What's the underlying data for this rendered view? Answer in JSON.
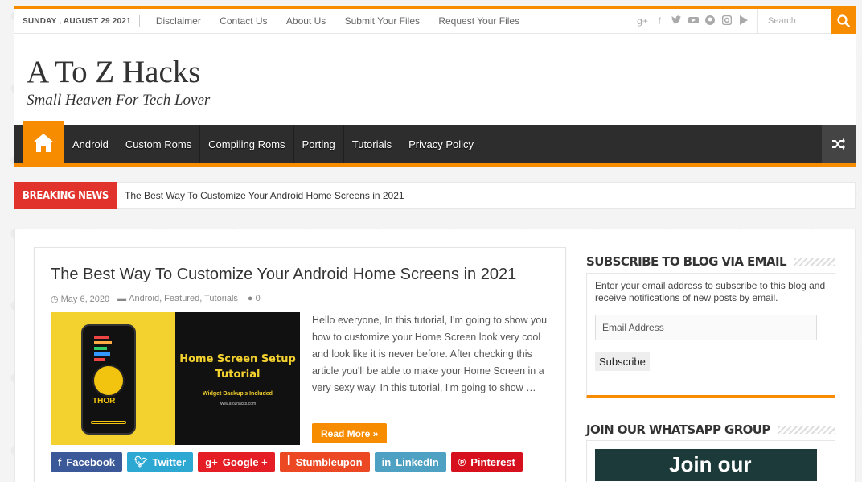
{
  "topbar": {
    "date": "SUNDAY , AUGUST 29 2021",
    "links": [
      "Disclaimer",
      "Contact Us",
      "About Us",
      "Submit Your Files",
      "Request Your Files"
    ],
    "social": [
      "google-plus",
      "facebook",
      "twitter",
      "youtube",
      "github",
      "instagram",
      "play"
    ],
    "search_placeholder": "Search"
  },
  "header": {
    "logo": "A To Z Hacks",
    "tagline": "Small Heaven For Tech Lover"
  },
  "nav": {
    "items": [
      "Android",
      "Custom Roms",
      "Compiling Roms",
      "Porting",
      "Tutorials",
      "Privacy Policy"
    ]
  },
  "breaking": {
    "label": "Breaking News",
    "text": "The Best Way To Customize Your Android Home Screens in 2021"
  },
  "post": {
    "title": "The Best Way To Customize Your Android Home Screens in 2021",
    "date": "May 6, 2020",
    "categories": "Android, Featured, Tutorials",
    "comments": "0",
    "thumb_title_1": "Home Screen Setup",
    "thumb_title_2": "Tutorial",
    "thumb_sub": "Widget Backup's Included",
    "thumb_url": "www.atozhacks.com",
    "thumb_badge": "THOR",
    "excerpt": "Hello everyone, In this tutorial, I'm going to show you how to customize your Home Screen look very cool and look like it is never before. After checking this article you'll be able to make your Home Screen in a very sexy way. In this tutorial, I'm going to show …",
    "read_more": "Read More »"
  },
  "share": [
    {
      "label": "Facebook",
      "icon": "f",
      "color": "#3b5998"
    },
    {
      "label": "Twitter",
      "icon": "t",
      "color": "#2ca8d2"
    },
    {
      "label": "Google +",
      "icon": "g+",
      "color": "#e51e25"
    },
    {
      "label": "Stumbleupon",
      "icon": "su",
      "color": "#eb4823"
    },
    {
      "label": "LinkedIn",
      "icon": "in",
      "color": "#4fa1c4"
    },
    {
      "label": "Pinterest",
      "icon": "p",
      "color": "#d6101d"
    }
  ],
  "sidebar": {
    "subscribe_title": "Subscribe to Blog via Email",
    "subscribe_desc": "Enter your email address to subscribe to this blog and receive notifications of new posts by email.",
    "email_placeholder": "Email Address",
    "subscribe_button": "Subscribe",
    "whatsapp_title": "Join Our WhatsApp Group",
    "whatsapp_banner": "Join our"
  },
  "colors": {
    "accent": "#f88c00",
    "nav_bg": "#2d2d2d",
    "breaking": "#e2322c"
  }
}
